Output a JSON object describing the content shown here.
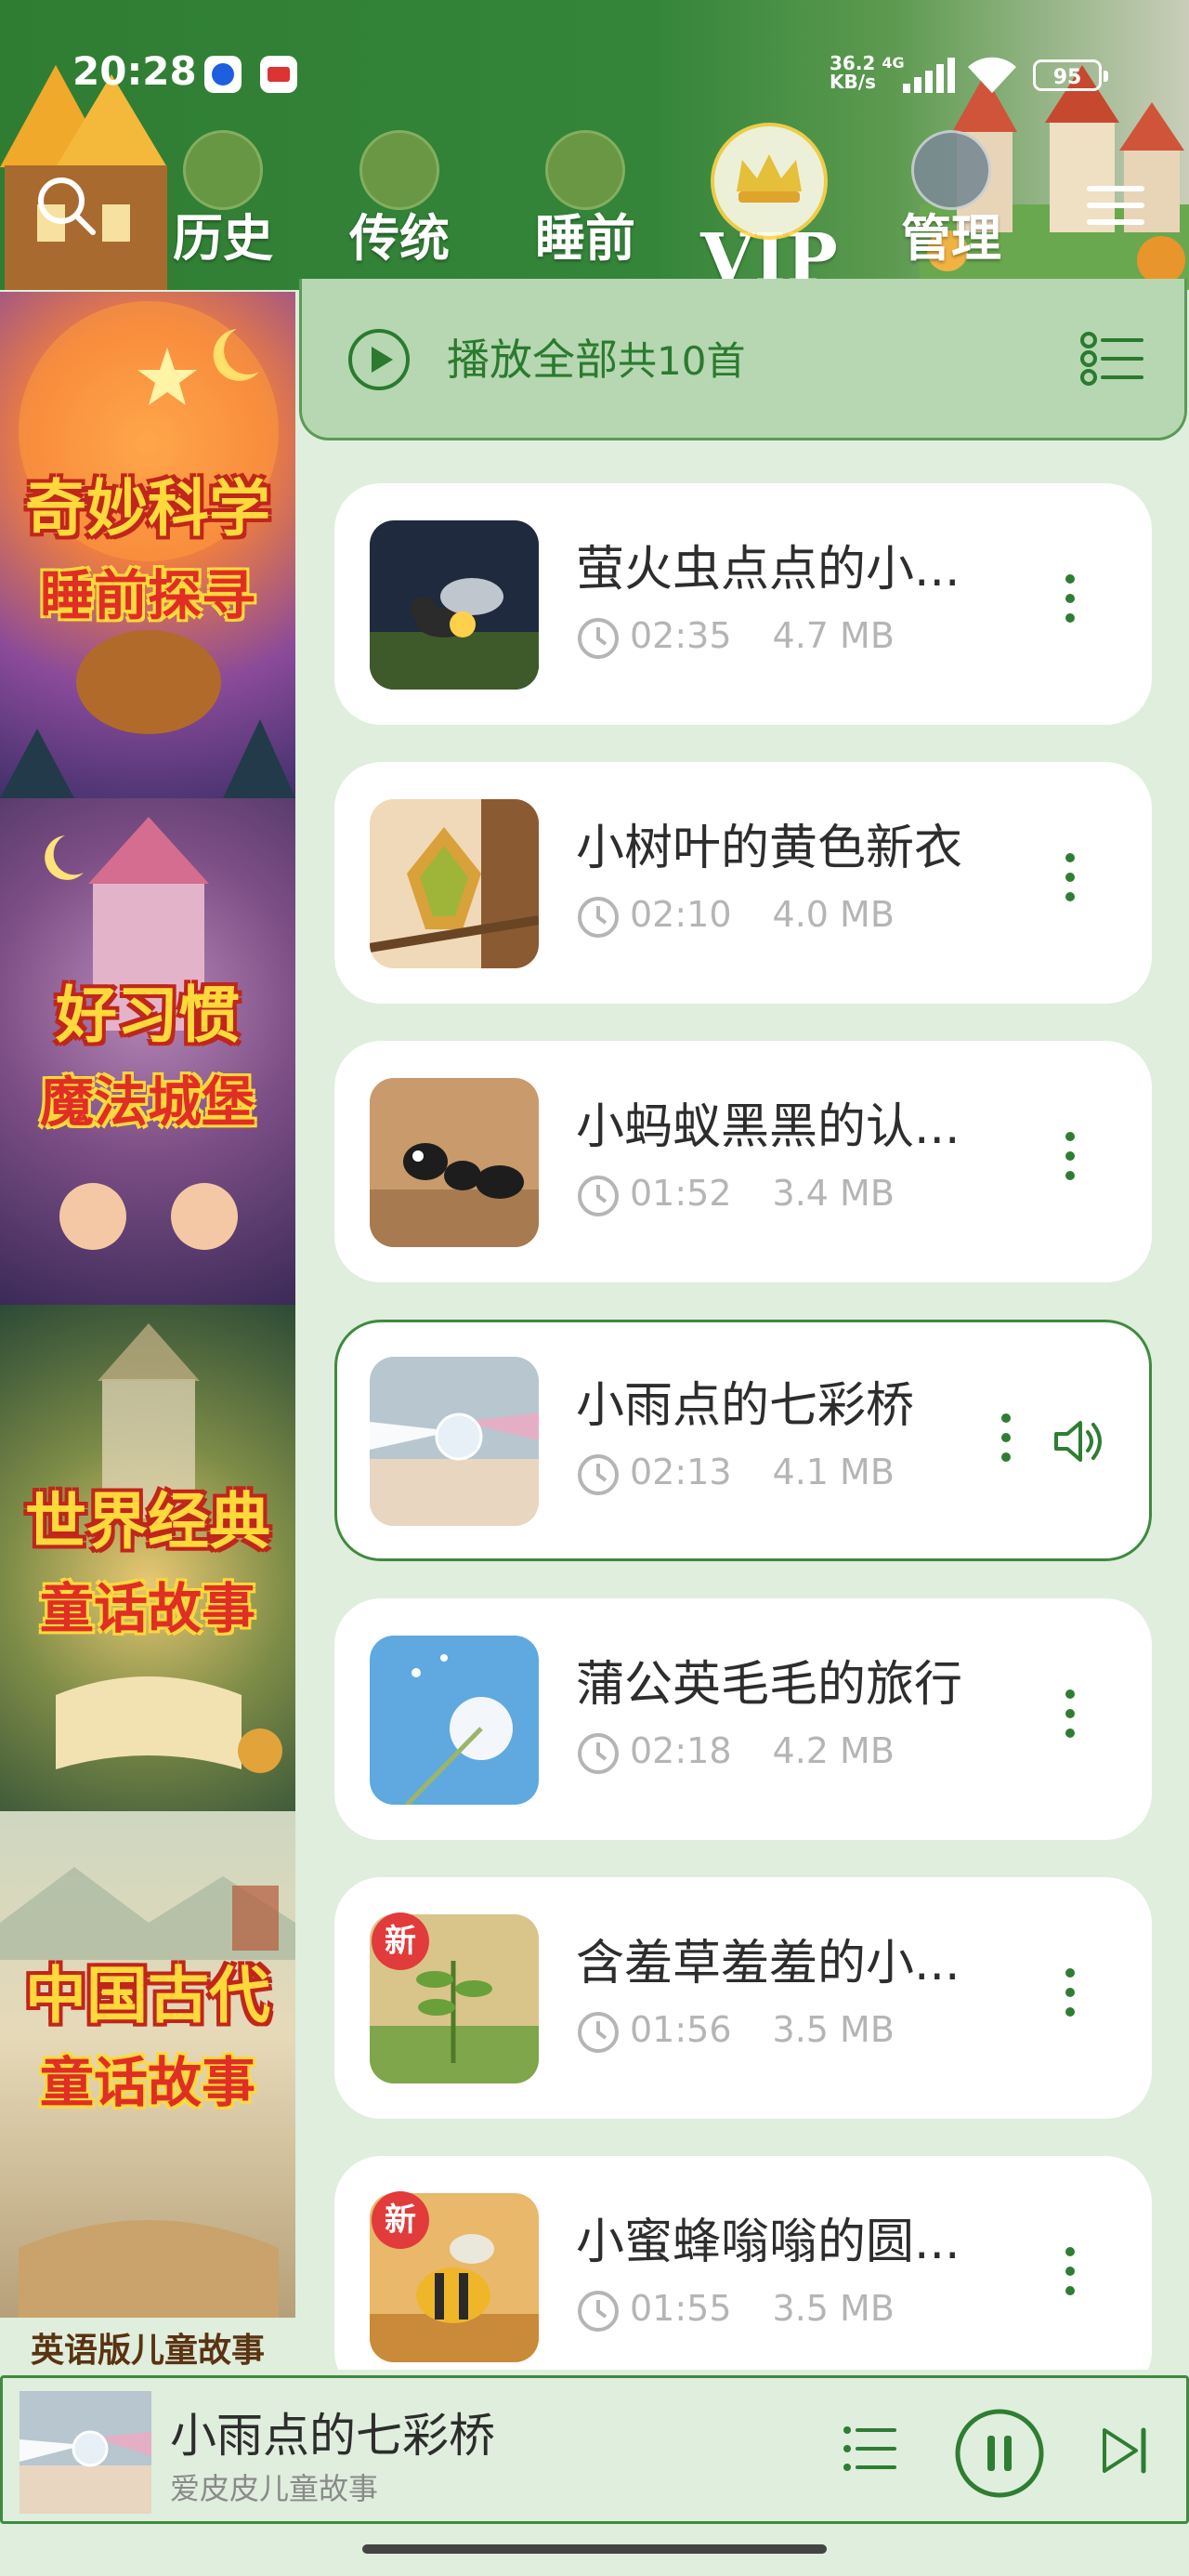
{
  "status_bar": {
    "time": "20:28",
    "net_speed": "36.2",
    "net_unit": "KB/s",
    "net_type": "4G",
    "battery": "95"
  },
  "header": {
    "tabs": [
      {
        "label": "历史",
        "icon": "history-badge-icon"
      },
      {
        "label": "传统",
        "icon": "tradition-badge-icon"
      },
      {
        "label": "睡前",
        "icon": "bedtime-badge-icon"
      },
      {
        "label": "VIP",
        "icon": "vip-crown-icon"
      },
      {
        "label": "管理",
        "icon": "manage-badge-icon"
      }
    ]
  },
  "categories": [
    {
      "line1": "奇妙科学",
      "line2": "睡前探寻"
    },
    {
      "line1": "好习惯",
      "line2": "魔法城堡"
    },
    {
      "line1": "世界经典",
      "line2": "童话故事"
    },
    {
      "line1": "中国古代",
      "line2": "童话故事"
    },
    {
      "line1": "英语版儿童故事",
      "line2": ""
    }
  ],
  "play_all": {
    "label": "播放全部",
    "count": "共10首"
  },
  "stories": [
    {
      "title": "萤火虫点点的小...",
      "duration": "02:35",
      "size": "4.7 MB",
      "new": false,
      "playing": false
    },
    {
      "title": "小树叶的黄色新衣",
      "duration": "02:10",
      "size": "4.0 MB",
      "new": false,
      "playing": false
    },
    {
      "title": "小蚂蚁黑黑的认...",
      "duration": "01:52",
      "size": "3.4 MB",
      "new": false,
      "playing": false
    },
    {
      "title": "小雨点的七彩桥",
      "duration": "02:13",
      "size": "4.1 MB",
      "new": false,
      "playing": true
    },
    {
      "title": "蒲公英毛毛的旅行",
      "duration": "02:18",
      "size": "4.2 MB",
      "new": false,
      "playing": false
    },
    {
      "title": "含羞草羞羞的小...",
      "duration": "01:56",
      "size": "3.5 MB",
      "new": true,
      "playing": false
    },
    {
      "title": "小蜜蜂嗡嗡的圆...",
      "duration": "01:55",
      "size": "3.5 MB",
      "new": true,
      "playing": false
    }
  ],
  "new_badge": "新",
  "player": {
    "title": "小雨点的七彩桥",
    "subtitle": "爱皮皮儿童故事"
  },
  "colors": {
    "primary": "#2f7d33",
    "background": "#dfeedd",
    "playall_bg": "#b6d7b1",
    "new_badge": "#e23b3b"
  }
}
